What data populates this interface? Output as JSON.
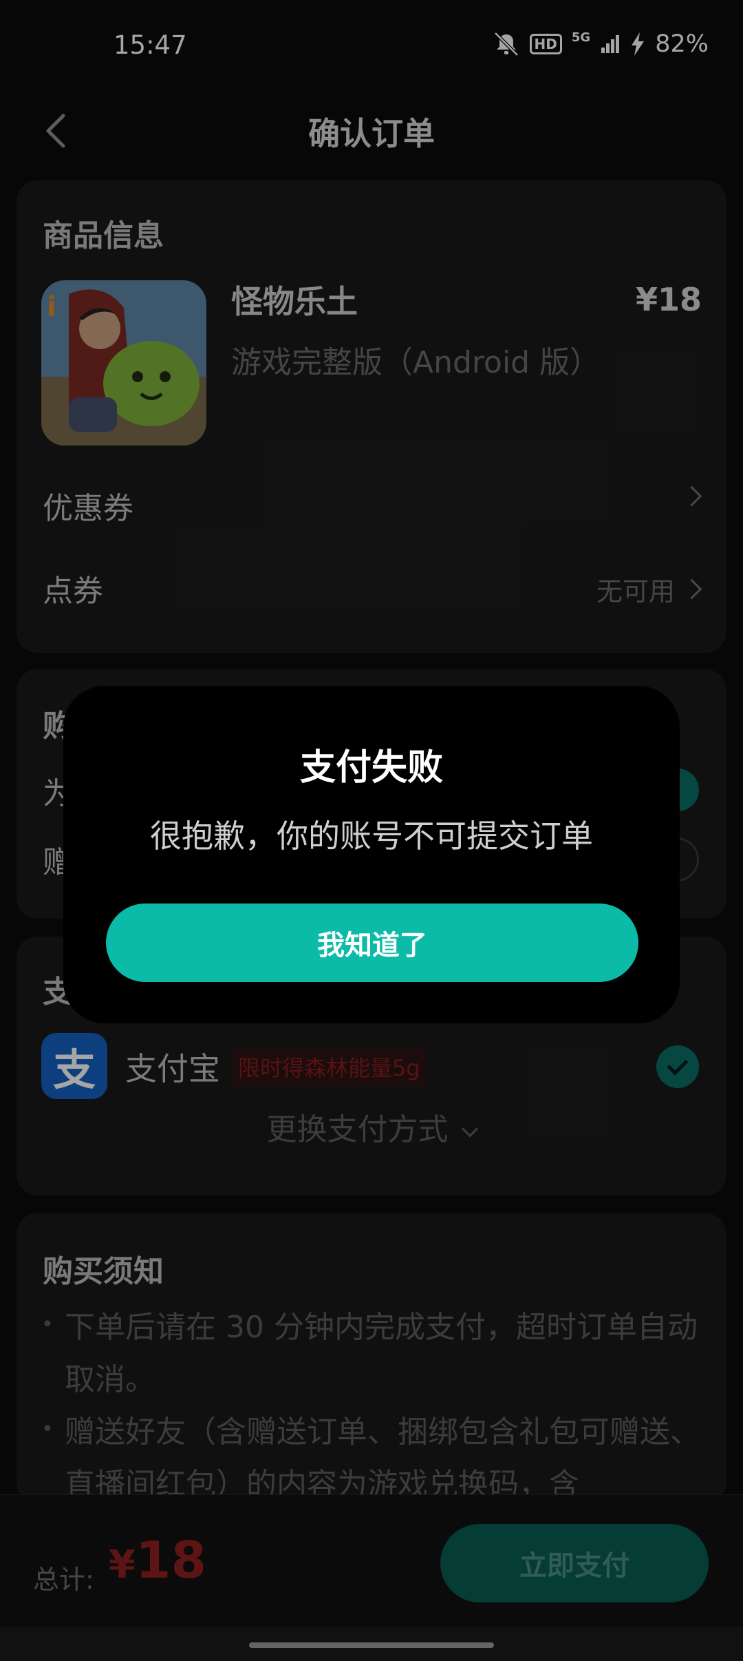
{
  "status": {
    "time": "15:47",
    "hd": "HD",
    "network": "5G",
    "battery": "82%"
  },
  "nav": {
    "title": "确认订单"
  },
  "product_card": {
    "section_title": "商品信息",
    "name": "怪物乐土",
    "edition": "游戏完整版（Android 版）",
    "price": "¥18",
    "coupon_label": "优惠券",
    "points_label": "点券",
    "points_value": "无可用"
  },
  "purchase_card": {
    "section_title_visible": "购",
    "row1_visible": "为",
    "row2_visible": "赠"
  },
  "payment_card": {
    "section_title_visible": "支",
    "method_label": "支付宝",
    "method_icon": "支",
    "promo": "限时得森林能量5g",
    "switch_label": "更换支付方式"
  },
  "notice_card": {
    "title": "购买须知",
    "items": [
      "下单后请在 30 分钟内完成支付，超时订单自动取消。",
      "赠送好友（含赠送订单、捆绑包含礼包可赠送、直播间红包）的内容为游戏兑换码，含"
    ]
  },
  "footer": {
    "total_label": "总计:",
    "currency": "¥",
    "total_amount": "18",
    "pay_button": "立即支付"
  },
  "dialog": {
    "title": "支付失败",
    "message": "很抱歉，你的账号不可提交订单",
    "button": "我知道了"
  },
  "colors": {
    "accent": "#0bbba8",
    "price_red": "#8e1f1f",
    "background": "#0b0b0b",
    "card": "#1a1a1a"
  }
}
